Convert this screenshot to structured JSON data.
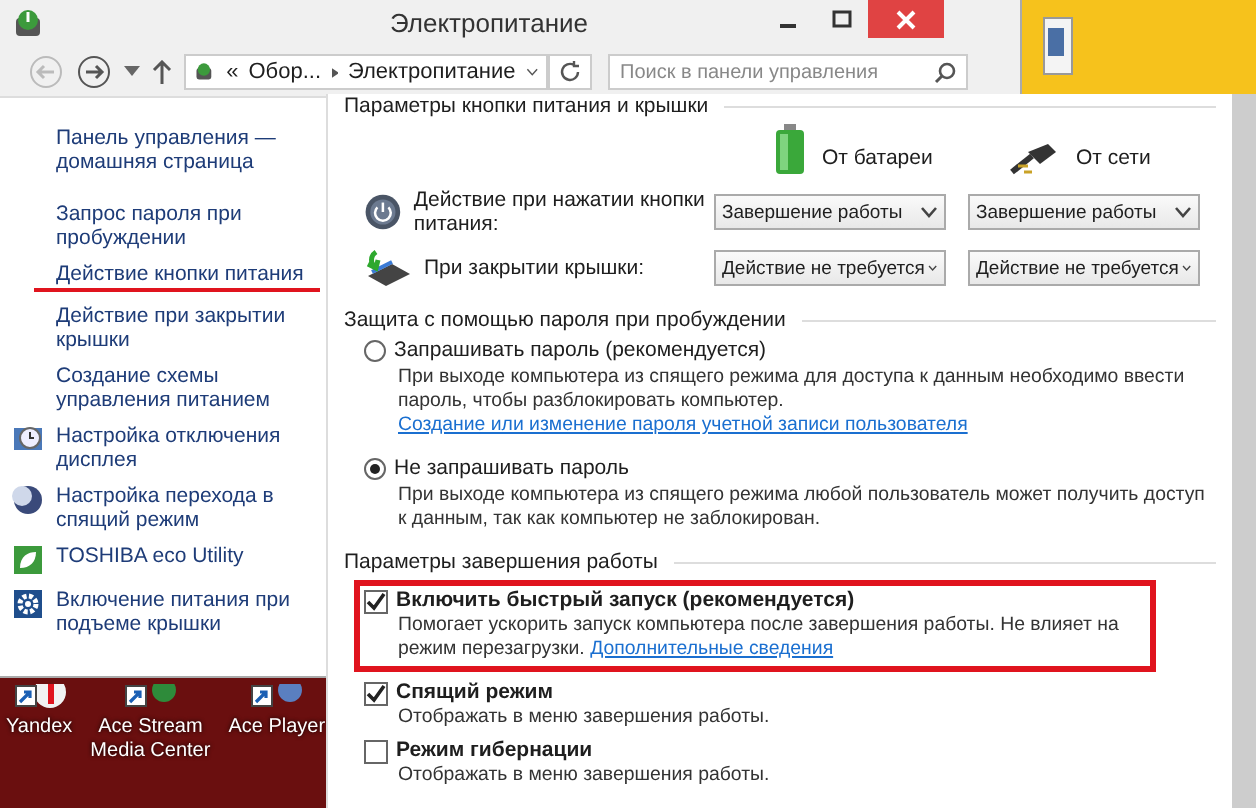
{
  "window": {
    "title": "Электропитание"
  },
  "address_bar": {
    "overflow": "«",
    "crumbs": [
      "Обор...",
      "Электропитание"
    ]
  },
  "search": {
    "placeholder": "Поиск в панели управления"
  },
  "sidebar": {
    "links": [
      {
        "label": "Панель управления — домашняя страница",
        "highlighted": false
      },
      {
        "label": "Запрос пароля при пробуждении",
        "highlighted": false
      },
      {
        "label": "Действие кнопки питания",
        "highlighted": true
      },
      {
        "label": "Действие при закрытии крышки",
        "highlighted": false
      },
      {
        "label": "Создание схемы управления питанием",
        "highlighted": false
      }
    ],
    "tools": [
      {
        "label": "Настройка отключения дисплея",
        "kind": "display"
      },
      {
        "label": "Настройка перехода в спящий режим",
        "kind": "sleep"
      },
      {
        "label": "TOSHIBA eco Utility",
        "kind": "eco"
      },
      {
        "label": "Включение питания при подъеме крышки",
        "kind": "gear"
      }
    ]
  },
  "desktop_icons": [
    {
      "label": "Yandex",
      "kind": "browser"
    },
    {
      "label": "Ace Stream Media Center",
      "kind": "media"
    },
    {
      "label": "Ace Player",
      "kind": "player"
    }
  ],
  "power_settings": {
    "heading": "Параметры кнопки питания и крышки",
    "columns": [
      {
        "label": "От батареи",
        "kind": "battery"
      },
      {
        "label": "От сети",
        "kind": "plug"
      }
    ],
    "rows": [
      {
        "label": "Действие при нажатии кнопки питания:",
        "kind": "power-button",
        "values": [
          "Завершение работы",
          "Завершение работы"
        ]
      },
      {
        "label": "При закрытии крышки:",
        "kind": "lid",
        "values": [
          "Действие не требуется",
          "Действие не требуется"
        ]
      }
    ]
  },
  "password": {
    "heading": "Защита с помощью пароля при пробуждении",
    "options": [
      {
        "label": "Запрашивать пароль (рекомендуется)",
        "selected": false,
        "description": "При выходе компьютера из спящего режима для доступа к данным необходимо ввести пароль, чтобы разблокировать компьютер.",
        "link": "Создание или изменение пароля учетной записи пользователя"
      },
      {
        "label": "Не запрашивать пароль",
        "selected": true,
        "description": "При выходе компьютера из спящего режима любой пользователь может получить доступ к данным, так как компьютер не заблокирован."
      }
    ]
  },
  "shutdown": {
    "heading": "Параметры завершения работы",
    "options": [
      {
        "label": "Включить быстрый запуск (рекомендуется)",
        "checked": true,
        "highlighted": true,
        "description": "Помогает ускорить запуск компьютера после завершения работы. Не влияет на режим перезагрузки.",
        "link": "Дополнительные сведения"
      },
      {
        "label": "Спящий режим",
        "checked": true,
        "highlighted": false,
        "description": "Отображать в меню завершения работы."
      },
      {
        "label": "Режим гибернации",
        "checked": false,
        "highlighted": false,
        "description": "Отображать в меню завершения работы."
      }
    ]
  }
}
